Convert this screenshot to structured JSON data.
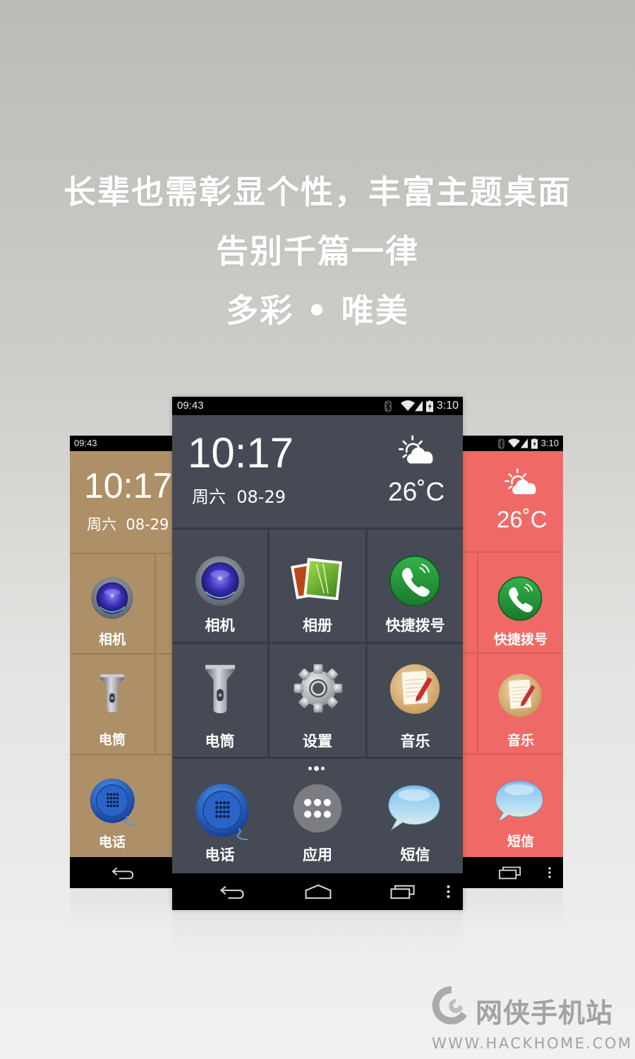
{
  "headline": {
    "line1": "长辈也需彰显个性，丰富主题桌面",
    "line2": "告别千篇一律",
    "line3": "多彩 • 唯美"
  },
  "status_bar": {
    "left_time": "09:43",
    "right_time": "3:10",
    "icons": [
      "bluetooth-icon",
      "wifi-icon",
      "signal-icon",
      "battery-charging-icon"
    ]
  },
  "widget": {
    "clock": "10:17",
    "date": "周六  08-29",
    "weather_icon": "partly-cloudy-icon",
    "temperature": "26˚C"
  },
  "apps": [
    {
      "label": "相机",
      "icon": "camera-icon"
    },
    {
      "label": "相册",
      "icon": "gallery-icon"
    },
    {
      "label": "快捷拨号",
      "icon": "speed-dial-icon"
    },
    {
      "label": "电筒",
      "icon": "flashlight-icon"
    },
    {
      "label": "设置",
      "icon": "settings-gear-icon"
    },
    {
      "label": "音乐",
      "icon": "notepad-icon"
    }
  ],
  "dock": [
    {
      "label": "电话",
      "icon": "phone-dialer-icon"
    },
    {
      "label": "应用",
      "icon": "app-drawer-icon"
    },
    {
      "label": "短信",
      "icon": "message-bubble-icon"
    }
  ],
  "nav": [
    "back-icon",
    "home-icon",
    "recents-icon",
    "menu-icon"
  ],
  "themes": {
    "left": {
      "color": "#ae9068"
    },
    "center": {
      "color": "#454a54"
    },
    "right": {
      "color": "#ef6a66"
    }
  },
  "watermark": {
    "name": "网侠手机站",
    "url": "WWW.HACKHOME.COM"
  }
}
